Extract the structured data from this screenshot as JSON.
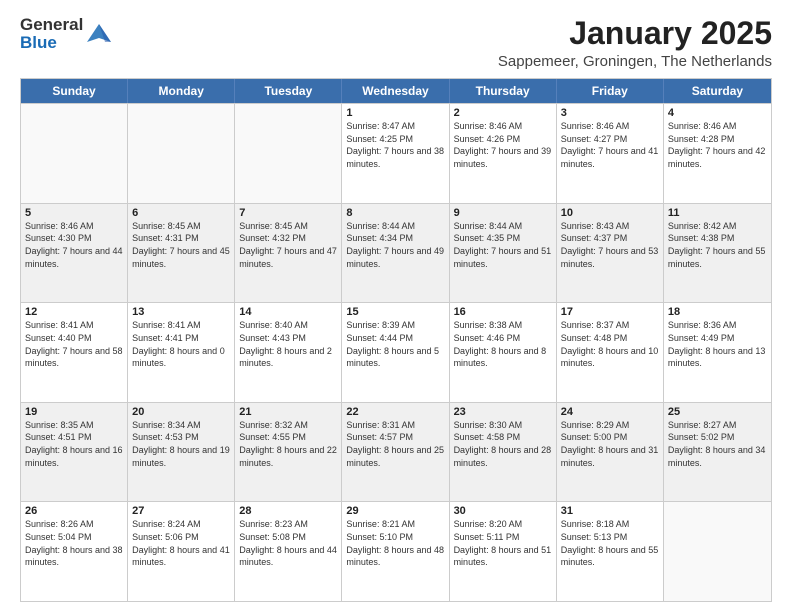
{
  "logo": {
    "general": "General",
    "blue": "Blue"
  },
  "title": "January 2025",
  "location": "Sappemeer, Groningen, The Netherlands",
  "header_days": [
    "Sunday",
    "Monday",
    "Tuesday",
    "Wednesday",
    "Thursday",
    "Friday",
    "Saturday"
  ],
  "weeks": [
    [
      {
        "day": "",
        "empty": true
      },
      {
        "day": "",
        "empty": true
      },
      {
        "day": "",
        "empty": true
      },
      {
        "day": "1",
        "sunrise": "Sunrise: 8:47 AM",
        "sunset": "Sunset: 4:25 PM",
        "daylight": "Daylight: 7 hours and 38 minutes."
      },
      {
        "day": "2",
        "sunrise": "Sunrise: 8:46 AM",
        "sunset": "Sunset: 4:26 PM",
        "daylight": "Daylight: 7 hours and 39 minutes."
      },
      {
        "day": "3",
        "sunrise": "Sunrise: 8:46 AM",
        "sunset": "Sunset: 4:27 PM",
        "daylight": "Daylight: 7 hours and 41 minutes."
      },
      {
        "day": "4",
        "sunrise": "Sunrise: 8:46 AM",
        "sunset": "Sunset: 4:28 PM",
        "daylight": "Daylight: 7 hours and 42 minutes."
      }
    ],
    [
      {
        "day": "5",
        "sunrise": "Sunrise: 8:46 AM",
        "sunset": "Sunset: 4:30 PM",
        "daylight": "Daylight: 7 hours and 44 minutes."
      },
      {
        "day": "6",
        "sunrise": "Sunrise: 8:45 AM",
        "sunset": "Sunset: 4:31 PM",
        "daylight": "Daylight: 7 hours and 45 minutes."
      },
      {
        "day": "7",
        "sunrise": "Sunrise: 8:45 AM",
        "sunset": "Sunset: 4:32 PM",
        "daylight": "Daylight: 7 hours and 47 minutes."
      },
      {
        "day": "8",
        "sunrise": "Sunrise: 8:44 AM",
        "sunset": "Sunset: 4:34 PM",
        "daylight": "Daylight: 7 hours and 49 minutes."
      },
      {
        "day": "9",
        "sunrise": "Sunrise: 8:44 AM",
        "sunset": "Sunset: 4:35 PM",
        "daylight": "Daylight: 7 hours and 51 minutes."
      },
      {
        "day": "10",
        "sunrise": "Sunrise: 8:43 AM",
        "sunset": "Sunset: 4:37 PM",
        "daylight": "Daylight: 7 hours and 53 minutes."
      },
      {
        "day": "11",
        "sunrise": "Sunrise: 8:42 AM",
        "sunset": "Sunset: 4:38 PM",
        "daylight": "Daylight: 7 hours and 55 minutes."
      }
    ],
    [
      {
        "day": "12",
        "sunrise": "Sunrise: 8:41 AM",
        "sunset": "Sunset: 4:40 PM",
        "daylight": "Daylight: 7 hours and 58 minutes."
      },
      {
        "day": "13",
        "sunrise": "Sunrise: 8:41 AM",
        "sunset": "Sunset: 4:41 PM",
        "daylight": "Daylight: 8 hours and 0 minutes."
      },
      {
        "day": "14",
        "sunrise": "Sunrise: 8:40 AM",
        "sunset": "Sunset: 4:43 PM",
        "daylight": "Daylight: 8 hours and 2 minutes."
      },
      {
        "day": "15",
        "sunrise": "Sunrise: 8:39 AM",
        "sunset": "Sunset: 4:44 PM",
        "daylight": "Daylight: 8 hours and 5 minutes."
      },
      {
        "day": "16",
        "sunrise": "Sunrise: 8:38 AM",
        "sunset": "Sunset: 4:46 PM",
        "daylight": "Daylight: 8 hours and 8 minutes."
      },
      {
        "day": "17",
        "sunrise": "Sunrise: 8:37 AM",
        "sunset": "Sunset: 4:48 PM",
        "daylight": "Daylight: 8 hours and 10 minutes."
      },
      {
        "day": "18",
        "sunrise": "Sunrise: 8:36 AM",
        "sunset": "Sunset: 4:49 PM",
        "daylight": "Daylight: 8 hours and 13 minutes."
      }
    ],
    [
      {
        "day": "19",
        "sunrise": "Sunrise: 8:35 AM",
        "sunset": "Sunset: 4:51 PM",
        "daylight": "Daylight: 8 hours and 16 minutes."
      },
      {
        "day": "20",
        "sunrise": "Sunrise: 8:34 AM",
        "sunset": "Sunset: 4:53 PM",
        "daylight": "Daylight: 8 hours and 19 minutes."
      },
      {
        "day": "21",
        "sunrise": "Sunrise: 8:32 AM",
        "sunset": "Sunset: 4:55 PM",
        "daylight": "Daylight: 8 hours and 22 minutes."
      },
      {
        "day": "22",
        "sunrise": "Sunrise: 8:31 AM",
        "sunset": "Sunset: 4:57 PM",
        "daylight": "Daylight: 8 hours and 25 minutes."
      },
      {
        "day": "23",
        "sunrise": "Sunrise: 8:30 AM",
        "sunset": "Sunset: 4:58 PM",
        "daylight": "Daylight: 8 hours and 28 minutes."
      },
      {
        "day": "24",
        "sunrise": "Sunrise: 8:29 AM",
        "sunset": "Sunset: 5:00 PM",
        "daylight": "Daylight: 8 hours and 31 minutes."
      },
      {
        "day": "25",
        "sunrise": "Sunrise: 8:27 AM",
        "sunset": "Sunset: 5:02 PM",
        "daylight": "Daylight: 8 hours and 34 minutes."
      }
    ],
    [
      {
        "day": "26",
        "sunrise": "Sunrise: 8:26 AM",
        "sunset": "Sunset: 5:04 PM",
        "daylight": "Daylight: 8 hours and 38 minutes."
      },
      {
        "day": "27",
        "sunrise": "Sunrise: 8:24 AM",
        "sunset": "Sunset: 5:06 PM",
        "daylight": "Daylight: 8 hours and 41 minutes."
      },
      {
        "day": "28",
        "sunrise": "Sunrise: 8:23 AM",
        "sunset": "Sunset: 5:08 PM",
        "daylight": "Daylight: 8 hours and 44 minutes."
      },
      {
        "day": "29",
        "sunrise": "Sunrise: 8:21 AM",
        "sunset": "Sunset: 5:10 PM",
        "daylight": "Daylight: 8 hours and 48 minutes."
      },
      {
        "day": "30",
        "sunrise": "Sunrise: 8:20 AM",
        "sunset": "Sunset: 5:11 PM",
        "daylight": "Daylight: 8 hours and 51 minutes."
      },
      {
        "day": "31",
        "sunrise": "Sunrise: 8:18 AM",
        "sunset": "Sunset: 5:13 PM",
        "daylight": "Daylight: 8 hours and 55 minutes."
      },
      {
        "day": "",
        "empty": true
      }
    ]
  ]
}
